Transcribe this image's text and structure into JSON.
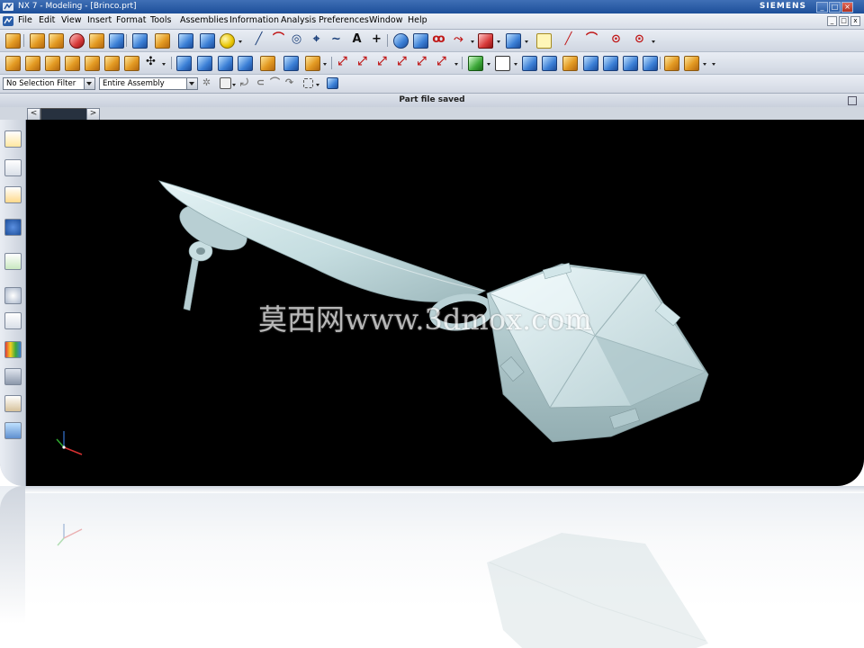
{
  "window": {
    "title": "NX 7 - Modeling - [Brinco.prt]",
    "brand": "SIEMENS",
    "controls": [
      "_",
      "□",
      "x"
    ]
  },
  "menu": {
    "items": [
      "File",
      "Edit",
      "View",
      "Insert",
      "Format",
      "Tools",
      "Assemblies",
      "Information",
      "Analysis",
      "Preferences",
      "Window",
      "Help"
    ]
  },
  "filters": {
    "selection_filter": "No Selection Filter",
    "scope": "Entire Assembly"
  },
  "status": {
    "message": "Part file saved"
  },
  "watermark": {
    "text": "莫西网www.3dmox.com"
  },
  "colors": {
    "viewport_bg": "#000000",
    "model_fill": "#cfe4e7",
    "model_shadow": "#8fa9ad",
    "title_blue": "#1d4f99"
  }
}
